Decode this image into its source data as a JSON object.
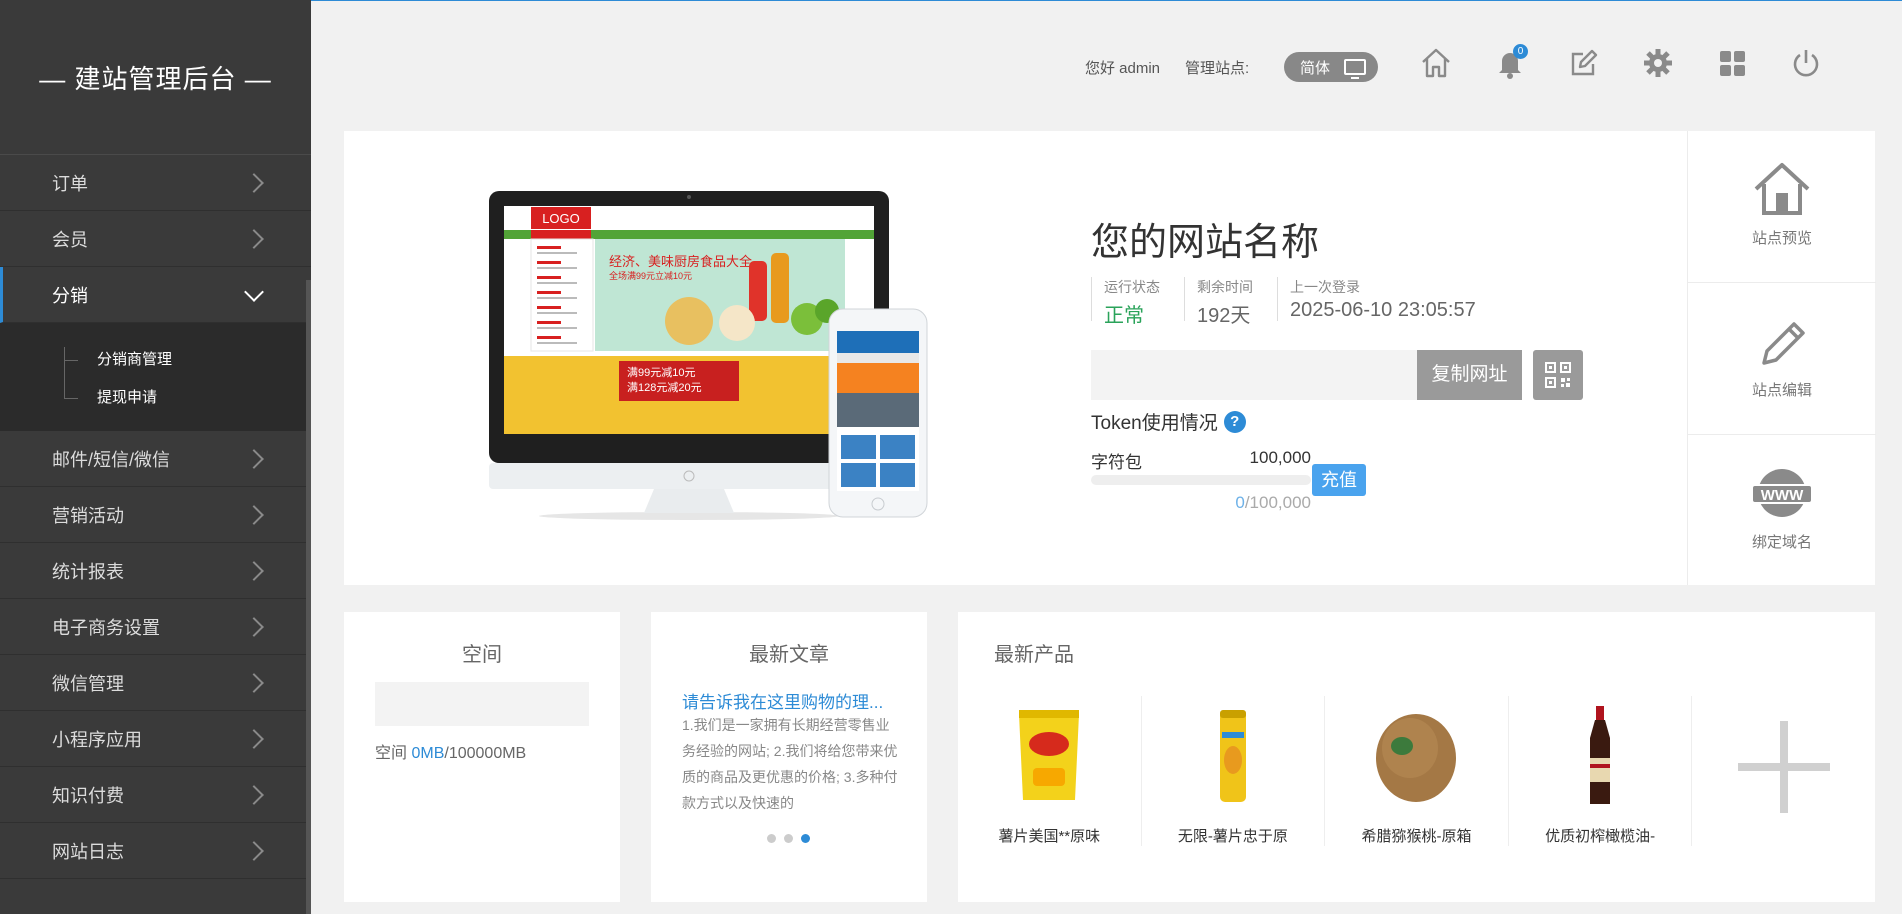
{
  "brand": "— 建站管理后台 —",
  "menu": {
    "orders": "订单",
    "members": "会员",
    "distribution": "分销",
    "distribution_sub": [
      "分销商管理",
      "提现申请"
    ],
    "mail": "邮件/短信/微信",
    "marketing": "营销活动",
    "reports": "统计报表",
    "ecommerce": "电子商务设置",
    "wechat": "微信管理",
    "miniapp": "小程序应用",
    "knowledge": "知识付费",
    "logs": "网站日志"
  },
  "header": {
    "greeting": "您好 admin",
    "site_label": "管理站点:",
    "language": "简体",
    "notification_count": "0"
  },
  "site": {
    "name": "您的网站名称",
    "status_label": "运行状态",
    "status_value": "正常",
    "remaining_label": "剩余时间",
    "remaining_value": "192天",
    "last_login_label": "上一次登录",
    "last_login_value": "2025-06-10 23:05:57",
    "copy_url_label": "复制网址",
    "token_title": "Token使用情况",
    "token_pkg_label": "字符包",
    "token_total": "100,000",
    "token_used": "0",
    "token_used_total": "/100,000",
    "token_fraction": 0,
    "recharge_label": "充值"
  },
  "mockup": {
    "logo": "LOGO",
    "banner1": "经济、美味厨房食品大全",
    "banner2": "全场满99元立减10元",
    "banner3": "满99元减10元",
    "banner4": "满128元减20元"
  },
  "quick": {
    "preview": "站点预览",
    "edit": "站点编辑",
    "domain": "绑定域名"
  },
  "space": {
    "title": "空间",
    "label": "空间",
    "used": "0MB",
    "total": "/100000MB"
  },
  "articles": {
    "title": "最新文章",
    "headline": "请告诉我在这里购物的理...",
    "body": "1.我们是一家拥有长期经营零售业务经验的网站; 2.我们将给您带来优质的商品及更优惠的价格; 3.多种付款方式以及快速的"
  },
  "products": {
    "title": "最新产品",
    "items": [
      "薯片美国**原味",
      "无限-薯片忠于原",
      "希腊猕猴桃-原箱",
      "优质初榨橄榄油-"
    ]
  },
  "colors": {
    "accent": "#2d8bd6",
    "sidebar": "#3a3a3a",
    "ok": "#2aa35a"
  }
}
